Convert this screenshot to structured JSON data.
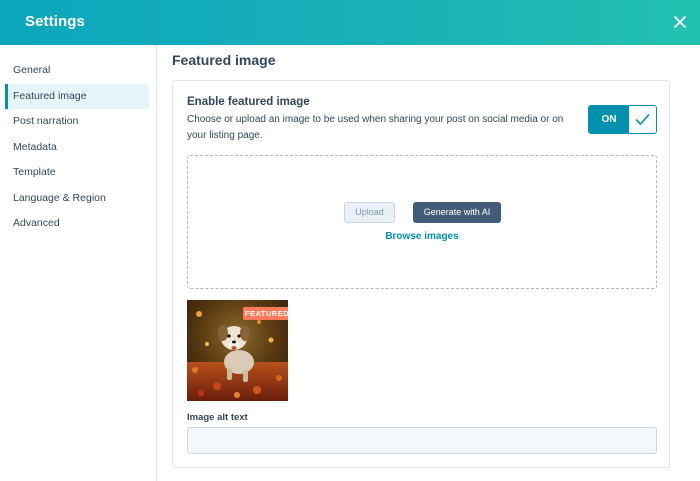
{
  "header": {
    "title": "Settings",
    "close_icon": "close-icon"
  },
  "sidebar": {
    "items": [
      {
        "label": "General",
        "active": false
      },
      {
        "label": "Featured image",
        "active": true
      },
      {
        "label": "Post narration",
        "active": false
      },
      {
        "label": "Metadata",
        "active": false
      },
      {
        "label": "Template",
        "active": false
      },
      {
        "label": "Language & Region",
        "active": false
      },
      {
        "label": "Advanced",
        "active": false
      }
    ]
  },
  "main": {
    "title": "Featured image",
    "enable": {
      "heading": "Enable featured image",
      "description": "Choose or upload an image to be used when sharing your post on social media or on your listing page.",
      "toggle_label": "ON",
      "toggle_state": true,
      "toggle_icon": "checkmark-icon"
    },
    "dropzone": {
      "upload_label": "Upload",
      "generate_label": "Generate with AI",
      "browse_label": "Browse images"
    },
    "thumbnail": {
      "badge": "FEATURED",
      "subject": "dog-running-through-autumn-leaves"
    },
    "alt_text": {
      "label": "Image alt text",
      "value": "",
      "placeholder": ""
    }
  },
  "colors": {
    "header_gradient_start": "#0ca6bd",
    "header_gradient_end": "#22c1b0",
    "accent": "#0091ae",
    "dark_button": "#425b76",
    "badge": "#ff7a59",
    "text": "#33475b"
  }
}
